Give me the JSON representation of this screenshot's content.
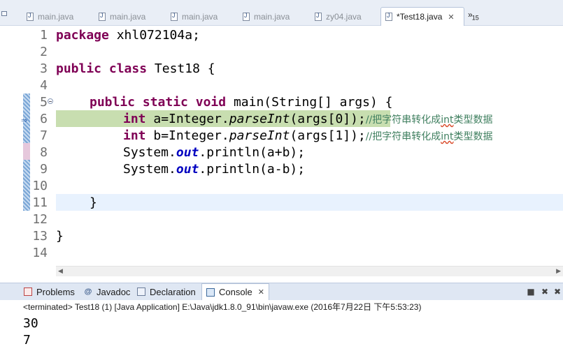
{
  "editor_tabs": [
    {
      "label": "main.java",
      "active": false
    },
    {
      "label": "main.java",
      "active": false
    },
    {
      "label": "main.java",
      "active": false
    },
    {
      "label": "main.java",
      "active": false
    },
    {
      "label": "zy04.java",
      "active": false
    },
    {
      "label": "*Test18.java",
      "active": true
    }
  ],
  "tab_overflow": {
    "chevron": "»",
    "count": "15"
  },
  "icons": {
    "file": "java-file-icon",
    "close": "close-icon",
    "fold": "fold-collapse-icon",
    "debug": "debug-arrow-icon"
  },
  "editor": {
    "line_numbers": [
      "1",
      "2",
      "3",
      "4",
      "5",
      "6",
      "7",
      "8",
      "9",
      "10",
      "11",
      "12",
      "13",
      "14"
    ],
    "lines": {
      "l1_kw": "package",
      "l1_rest": " xhl072104a;",
      "l3_kw1": "public",
      "l3_kw2": "class",
      "l3_rest": " Test18 {",
      "l5_kw1": "public",
      "l5_kw2": "static",
      "l5_kw3": "void",
      "l5_rest": " main(String[] args) {",
      "l6_kw": "int",
      "l6_a": " a=Integer.",
      "l6_it": "parseInt",
      "l6_b": "(args[0]);",
      "l7_kw": "int",
      "l7_a": " b=Integer.",
      "l7_it": "parseInt",
      "l7_b": "(args[1]);",
      "comment_pre": "//把字符串转化成",
      "comment_int": "int",
      "comment_post": "类型数据",
      "l8_a": "System.",
      "l8_field": "out",
      "l8_b": ".println(a+b);",
      "l9_a": "System.",
      "l9_field": "out",
      "l9_b": ".println(a-b);",
      "l11": "}",
      "l13": "}"
    }
  },
  "colors": {
    "keyword": "#7f0055",
    "comment": "#3f7f5f",
    "field": "#0000c0",
    "current_line_highlight": "#c8deb0",
    "selected_line": "#e8f2fe"
  },
  "panel_tabs": [
    {
      "label": "Problems",
      "icon": "problems-icon",
      "active": false
    },
    {
      "label": "Javadoc",
      "icon": "at-icon",
      "active": false
    },
    {
      "label": "Declaration",
      "icon": "declaration-icon",
      "active": false
    },
    {
      "label": "Console",
      "icon": "console-icon",
      "active": true
    }
  ],
  "console": {
    "header": "<terminated> Test18 (1) [Java Application] E:\\Java\\jdk1.8.0_91\\bin\\javaw.exe (2016年7月22日 下午5:53:23)",
    "output": [
      "30",
      "7"
    ]
  }
}
